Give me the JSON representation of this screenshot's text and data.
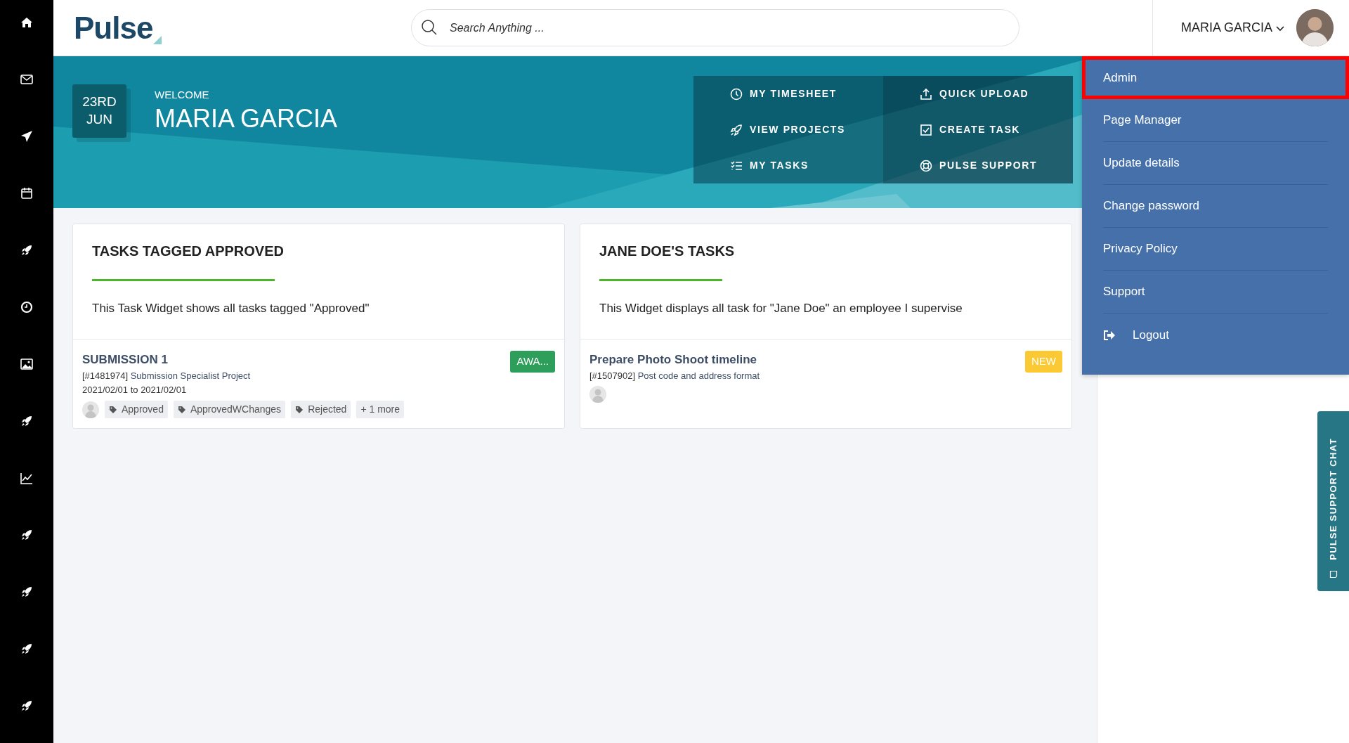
{
  "header": {
    "logo": "Pulse",
    "search": {
      "placeholder": "Search Anything ..."
    },
    "user": {
      "name": "MARIA GARCIA",
      "menu_open": true
    }
  },
  "banner": {
    "date": {
      "day": "23RD",
      "month": "JUN"
    },
    "welcome": "WELCOME",
    "name": "MARIA GARCIA"
  },
  "quick_links": [
    {
      "label": "MY TIMESHEET"
    },
    {
      "label": "QUICK UPLOAD"
    },
    {
      "label": "VIEW PROJECTS"
    },
    {
      "label": "CREATE TASK"
    },
    {
      "label": "MY TASKS"
    },
    {
      "label": "PULSE SUPPORT"
    }
  ],
  "widgets": [
    {
      "title": "TASKS TAGGED APPROVED",
      "description": "This Task Widget shows all tasks tagged \"Approved\"",
      "tasks": [
        {
          "title": "SUBMISSION 1",
          "ref": "[#1481974]",
          "project": "Submission Specialist Project",
          "dates": "2021/02/01 to 2021/02/01",
          "tags": [
            "Approved",
            "ApprovedWChanges",
            "Rejected"
          ],
          "more": "+ 1 more",
          "status": "AWA...",
          "color": "#2e9e5b"
        }
      ]
    },
    {
      "title": "JANE DOE'S TASKS",
      "description": "This Widget displays all task for \"Jane Doe\" an employee I supervise",
      "tasks": [
        {
          "title": "Prepare Photo Shoot timeline",
          "ref": "[#1507902]",
          "project": "Post code and address format",
          "status": "NEW",
          "color": "#fbc933"
        }
      ]
    }
  ],
  "user_menu": [
    {
      "label": "Admin",
      "kind": "link",
      "highlighted": true
    },
    {
      "label": "Page Manager",
      "kind": "link",
      "highlighted": false
    },
    {
      "label": "Update details",
      "kind": "link",
      "highlighted": false
    },
    {
      "label": "Change password",
      "kind": "link",
      "highlighted": false
    },
    {
      "label": "Privacy Policy",
      "kind": "link",
      "highlighted": false
    },
    {
      "label": "Support",
      "kind": "link",
      "highlighted": false
    },
    {
      "label": "Logout",
      "kind": "logout",
      "highlighted": false
    }
  ],
  "support_chat": {
    "label": "PULSE SUPPORT CHAT"
  }
}
